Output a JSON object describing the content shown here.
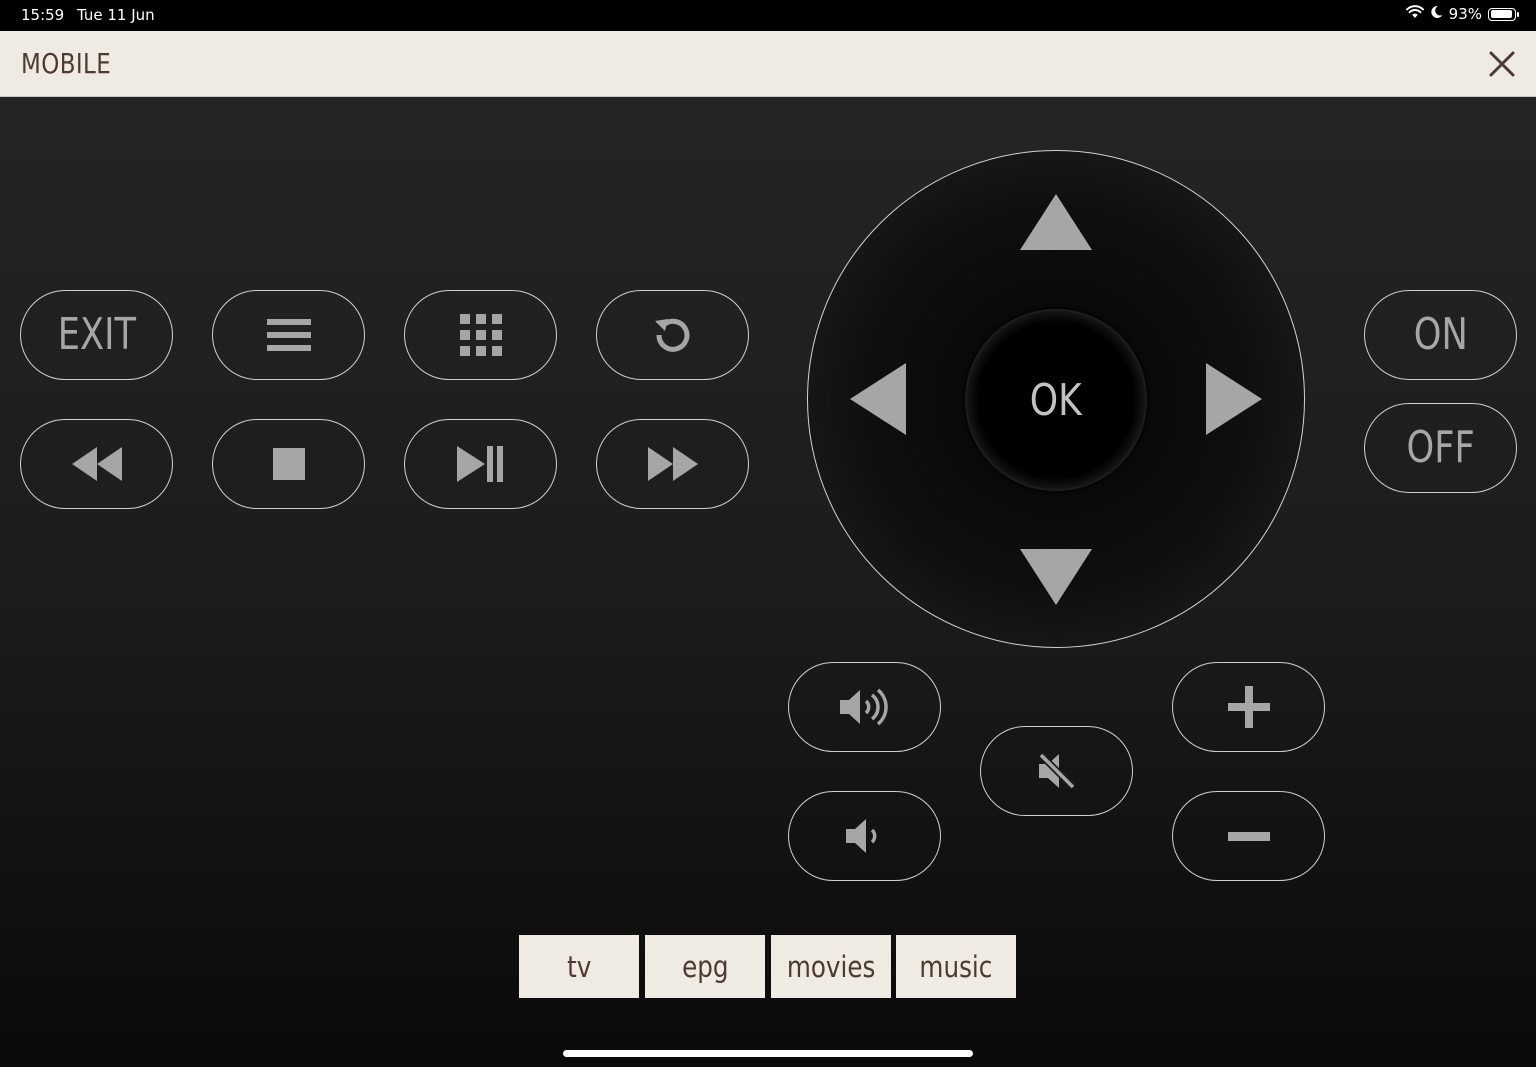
{
  "status_bar": {
    "time": "15:59",
    "date": "Tue 11 Jun",
    "battery": "93%",
    "battery_level": 0.93,
    "icons": [
      "wifi-icon",
      "moon-icon",
      "battery-icon"
    ]
  },
  "header": {
    "title": "MOBILE",
    "close_icon": "close-icon"
  },
  "controls": {
    "exit_label": "EXIT",
    "menu_icon": "menu-icon",
    "grid_icon": "grid-icon",
    "back_icon": "back-icon",
    "rewind_icon": "rewind-icon",
    "stop_icon": "stop-icon",
    "play_pause_icon": "play-pause-icon",
    "fast_forward_icon": "fast-forward-icon"
  },
  "dpad": {
    "ok_label": "OK",
    "icons": [
      "arrow-up-icon",
      "arrow-left-icon",
      "arrow-right-icon",
      "arrow-down-icon"
    ]
  },
  "power": {
    "on_label": "ON",
    "off_label": "OFF"
  },
  "volume": {
    "icons": [
      "volume-up-icon",
      "volume-down-icon",
      "mute-icon"
    ]
  },
  "channel": {
    "icons": [
      "plus-icon",
      "minus-icon"
    ]
  },
  "tabs": [
    {
      "label": "tv"
    },
    {
      "label": "epg"
    },
    {
      "label": "movies"
    },
    {
      "label": "music"
    }
  ],
  "colors": {
    "background": "#1c1c1c",
    "header_bg": "#efebe2",
    "header_text": "#4e3a31",
    "button_border": "#cfcfcf",
    "button_icon": "#a6a6a6"
  }
}
